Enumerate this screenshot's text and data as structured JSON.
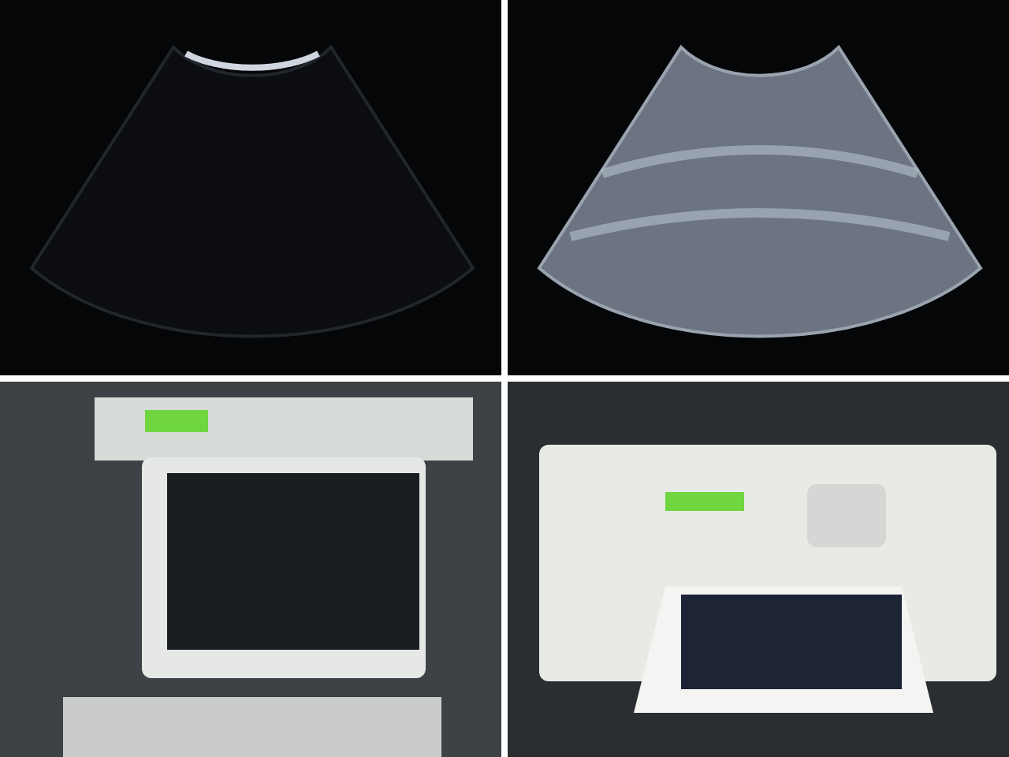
{
  "photos": [
    {
      "kind": "scan-faint"
    },
    {
      "kind": "scan-bright"
    },
    {
      "kind": "printer-side"
    },
    {
      "kind": "printer-front"
    }
  ]
}
